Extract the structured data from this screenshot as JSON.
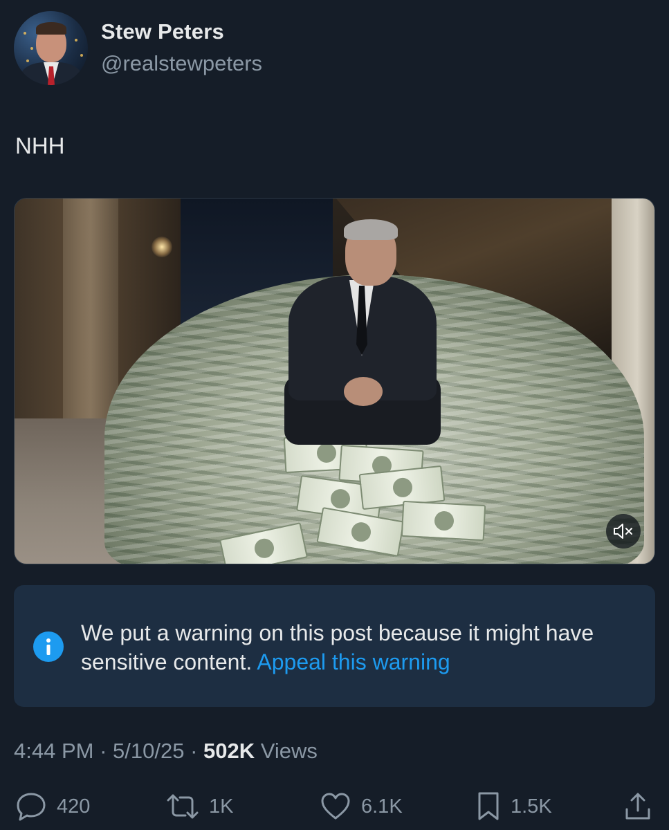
{
  "author": {
    "display_name": "Stew Peters",
    "handle": "@realstewpeters"
  },
  "tweet": {
    "text": "NHH"
  },
  "media": {
    "mute_icon": "speaker-muted-icon"
  },
  "warning": {
    "icon": "info-icon",
    "message": "We put a warning on this post because it might have sensitive content.",
    "link_label": "Appeal this warning"
  },
  "meta": {
    "time": "4:44 PM",
    "separator": "·",
    "date": "5/10/25",
    "views_count": "502K",
    "views_label": "Views"
  },
  "actions": {
    "replies": "420",
    "reposts": "1K",
    "likes": "6.1K",
    "bookmarks": "1.5K"
  },
  "colors": {
    "background": "#151d28",
    "accent": "#1d9bf0",
    "warning_bg": "#1d2e42",
    "muted_text": "#8b98a5"
  }
}
